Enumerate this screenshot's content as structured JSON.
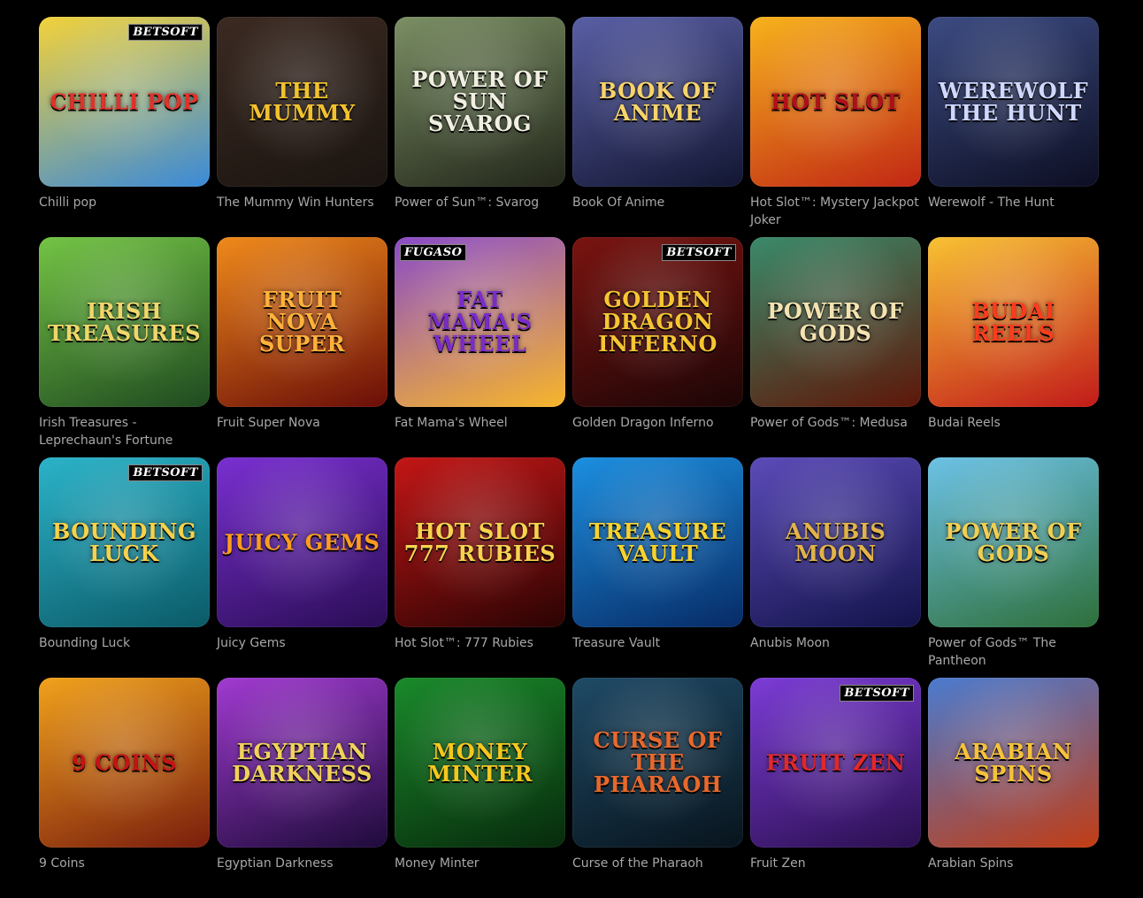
{
  "games": [
    {
      "name": "Chilli pop",
      "art": "Chilli Pop",
      "badge": "BETSOFT",
      "bg1": "#f3d23a",
      "bg2": "#3a8ad9",
      "ink": "#e0322a"
    },
    {
      "name": "The Mummy Win Hunters",
      "art": "The Mummy",
      "badge": "",
      "bg1": "#3b2a22",
      "bg2": "#1a1410",
      "ink": "#f2c22d"
    },
    {
      "name": "Power of Sun™: Svarog",
      "art": "Power of Sun Svarog",
      "badge": "",
      "bg1": "#7b8f64",
      "bg2": "#22261a",
      "ink": "#f1efe1"
    },
    {
      "name": "Book Of Anime",
      "art": "Book of Anime",
      "badge": "",
      "bg1": "#5a5fa6",
      "bg2": "#121632",
      "ink": "#f7d36b"
    },
    {
      "name": "Hot Slot™: Mystery Jackpot Joker",
      "art": "Hot Slot",
      "badge": "",
      "bg1": "#f7b21c",
      "bg2": "#c12714",
      "ink": "#b0101a"
    },
    {
      "name": "Werewolf - The Hunt",
      "art": "Werewolf The Hunt",
      "badge": "",
      "bg1": "#3c4b82",
      "bg2": "#0c0e22",
      "ink": "#cfd8ff"
    },
    {
      "name": "Irish Treasures - Leprechaun's Fortune",
      "art": "Irish Treasures",
      "badge": "",
      "bg1": "#74c445",
      "bg2": "#1f4a20",
      "ink": "#f0d66b"
    },
    {
      "name": "Fruit Super Nova",
      "art": "Fruit Nova Super",
      "badge": "",
      "bg1": "#f08a1b",
      "bg2": "#6a0d08",
      "ink": "#ffb23b"
    },
    {
      "name": "Fat Mama's Wheel",
      "art": "Fat Mama's Wheel",
      "badge": "FUGASO",
      "bg1": "#8a4bc9",
      "bg2": "#f7b62a",
      "ink": "#7b2bc9"
    },
    {
      "name": "Golden Dragon Inferno",
      "art": "Golden Dragon Inferno",
      "badge": "BETSOFT",
      "bg1": "#7a1410",
      "bg2": "#1c0506",
      "ink": "#f6c532"
    },
    {
      "name": "Power of Gods™: Medusa",
      "art": "Power of Gods",
      "badge": "",
      "bg1": "#3a8a6a",
      "bg2": "#5e1608",
      "ink": "#f4e2b0"
    },
    {
      "name": "Budai Reels",
      "art": "Budai Reels",
      "badge": "",
      "bg1": "#f8c233",
      "bg2": "#c21a1a",
      "ink": "#ff3b1e"
    },
    {
      "name": "Bounding Luck",
      "art": "Bounding Luck",
      "badge": "BETSOFT",
      "bg1": "#2bb3c9",
      "bg2": "#0b5a67",
      "ink": "#f6d24b"
    },
    {
      "name": "Juicy Gems",
      "art": "Juicy Gems",
      "badge": "",
      "bg1": "#7a2fd1",
      "bg2": "#2a0d55",
      "ink": "#ff9c1e"
    },
    {
      "name": "Hot Slot™: 777 Rubies",
      "art": "Hot Slot 777 Rubies",
      "badge": "",
      "bg1": "#c41616",
      "bg2": "#2a0303",
      "ink": "#f8d24e"
    },
    {
      "name": "Treasure Vault",
      "art": "Treasure Vault",
      "badge": "",
      "bg1": "#1c8fe0",
      "bg2": "#072b66",
      "ink": "#f7d22e"
    },
    {
      "name": "Anubis Moon",
      "art": "Anubis Moon",
      "badge": "",
      "bg1": "#5b4bb8",
      "bg2": "#13134a",
      "ink": "#e2b34a"
    },
    {
      "name": "Power of Gods™ The Pantheon",
      "art": "Power of Gods",
      "badge": "",
      "bg1": "#6cc2e6",
      "bg2": "#2e6f3a",
      "ink": "#f1cf52"
    },
    {
      "name": "9 Coins",
      "art": "9 Coins",
      "badge": "",
      "bg1": "#f1a21c",
      "bg2": "#7a1d0d",
      "ink": "#c41414"
    },
    {
      "name": "Egyptian Darkness",
      "art": "Egyptian Darkness",
      "badge": "",
      "bg1": "#a13ad1",
      "bg2": "#1e0b3a",
      "ink": "#f1d25a"
    },
    {
      "name": "Money Minter",
      "art": "Money Minter",
      "badge": "",
      "bg1": "#1a8a2b",
      "bg2": "#072a0c",
      "ink": "#f5c71e"
    },
    {
      "name": "Curse of the Pharaoh",
      "art": "Curse of the Pharaoh",
      "badge": "",
      "bg1": "#1f4a66",
      "bg2": "#08141d",
      "ink": "#e8682b"
    },
    {
      "name": "Fruit Zen",
      "art": "Fruit Zen",
      "badge": "BETSOFT",
      "bg1": "#7c3cd6",
      "bg2": "#2a0f4f",
      "ink": "#e2282b"
    },
    {
      "name": "Arabian Spins",
      "art": "Arabian Spins",
      "badge": "",
      "bg1": "#4a7bd0",
      "bg2": "#c23d14",
      "ink": "#f6c23a"
    }
  ]
}
